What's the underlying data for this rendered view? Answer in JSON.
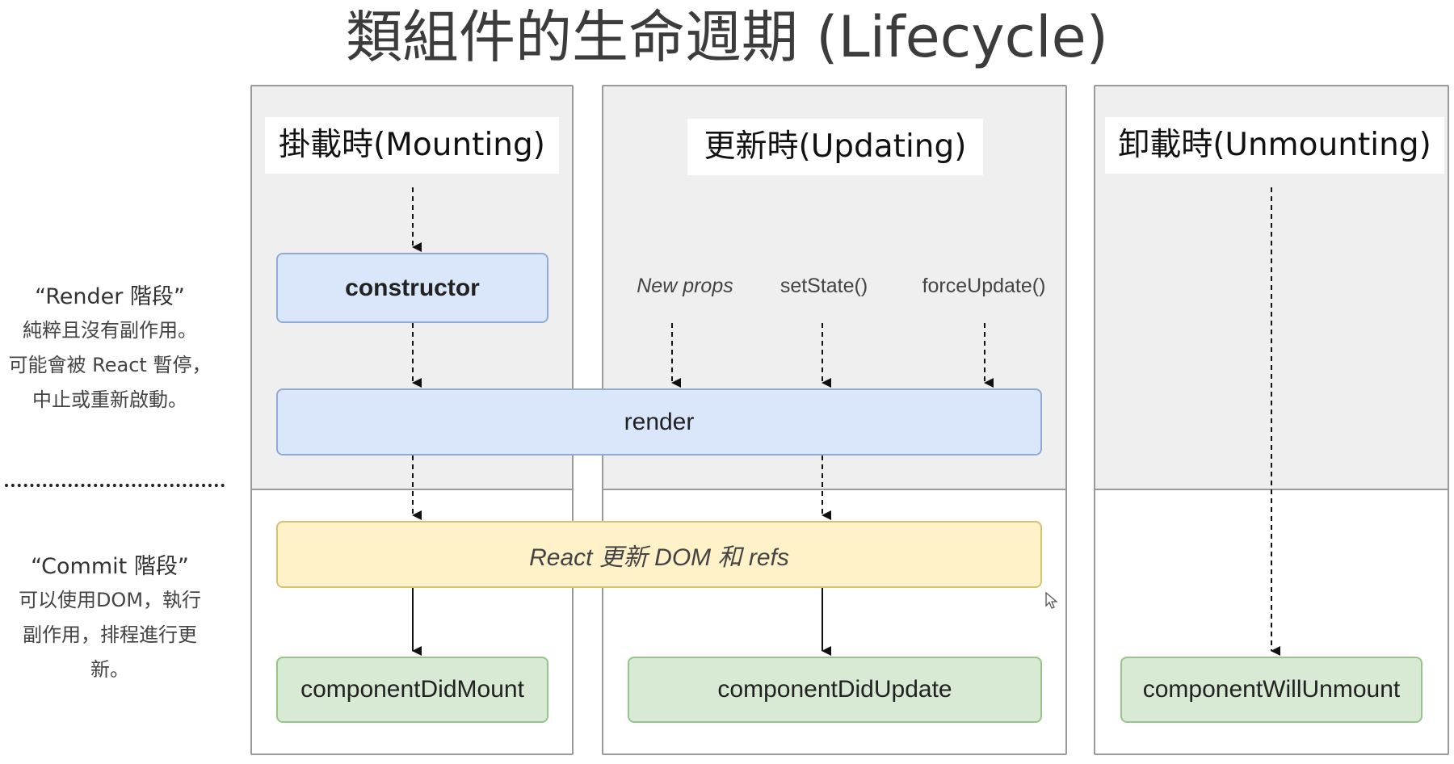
{
  "title": "類組件的生命週期 (Lifecycle)",
  "columns": {
    "mounting": {
      "header": "掛載時(Mounting)"
    },
    "updating": {
      "header": "更新時(Updating)"
    },
    "unmounting": {
      "header": "卸載時(Unmounting)"
    }
  },
  "boxes": {
    "constructor": "constructor",
    "render": "render",
    "react_update": "React 更新 DOM 和 refs",
    "did_mount": "componentDidMount",
    "did_update": "componentDidUpdate",
    "will_unmount": "componentWillUnmount"
  },
  "triggers": {
    "new_props": "New props",
    "set_state": "setState()",
    "force_update": "forceUpdate()"
  },
  "phases": {
    "render": {
      "label": "“Render 階段”",
      "lines": [
        "純粹且沒有副作用。",
        "可能會被 React 暫停，",
        "中止或重新啟動。"
      ]
    },
    "commit": {
      "label": "“Commit 階段”",
      "lines": [
        "可以使用DOM，執行",
        "副作用，排程進行更",
        "新。"
      ]
    }
  },
  "colors": {
    "blue_box": "#dae7fb",
    "yellow_box": "#fff1c8",
    "green_box": "#d8ead4",
    "column_bg": "#efefef"
  }
}
